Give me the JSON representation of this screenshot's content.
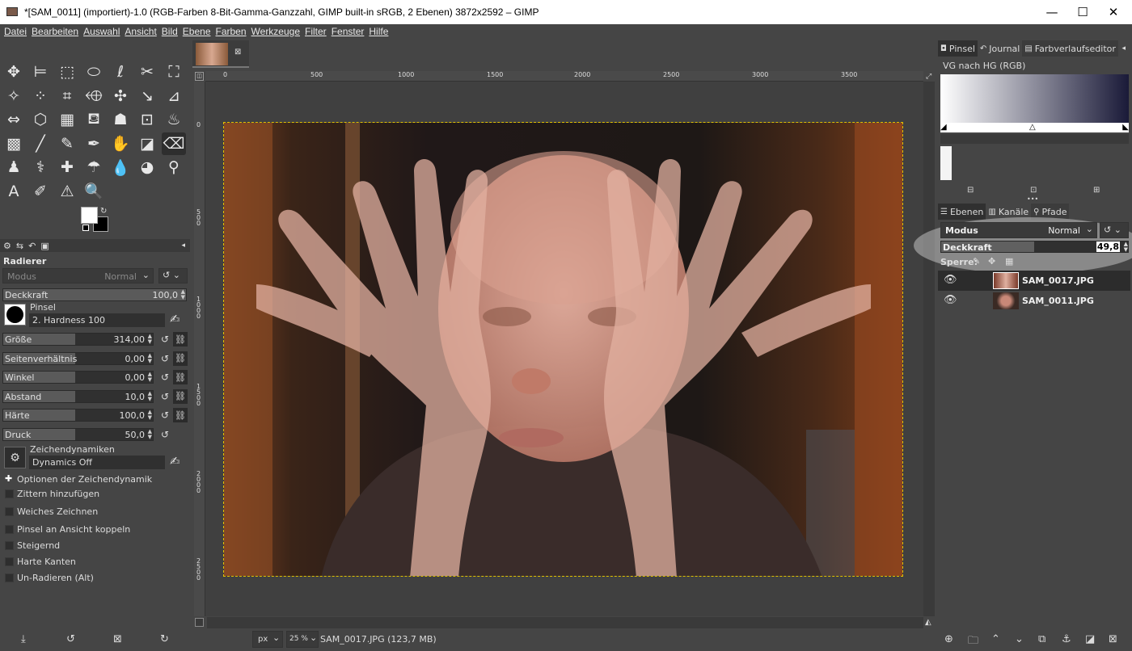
{
  "window": {
    "title": "*[SAM_0011] (importiert)-1.0 (RGB-Farben 8-Bit-Gamma-Ganzzahl, GIMP built-in sRGB, 2 Ebenen) 3872x2592 – GIMP",
    "minimize": "—",
    "maximize": "☐",
    "close": "✕"
  },
  "menu": [
    "Datei",
    "Bearbeiten",
    "Auswahl",
    "Ansicht",
    "Bild",
    "Ebene",
    "Farben",
    "Werkzeuge",
    "Filter",
    "Fenster",
    "Hilfe"
  ],
  "tools": [
    [
      "move-tool-icon",
      "✥"
    ],
    [
      "align-tool-icon",
      "⊨"
    ],
    [
      "rect-select-tool-icon",
      "⬚"
    ],
    [
      "ellipse-select-tool-icon",
      "⬭"
    ],
    [
      "free-select-tool-icon",
      "ℓ"
    ],
    [
      "scissors-tool-icon",
      "✂"
    ],
    [
      "foreground-select-tool-icon",
      "⛶"
    ],
    [
      "fuzzy-select-tool-icon",
      "✧"
    ],
    [
      "color-select-tool-icon",
      "⁘"
    ],
    [
      "crop-tool-icon",
      "⌗"
    ],
    [
      "unified-transform-tool-icon",
      "⬲"
    ],
    [
      "warp-transform-tool-icon",
      "✣"
    ],
    [
      "handle-transform-tool-icon",
      "↘"
    ],
    [
      "shear-tool-icon",
      "⊿"
    ],
    [
      "flip-tool-icon",
      "⇔"
    ],
    [
      "3d-transform-tool-icon",
      "⬡"
    ],
    [
      "cage-transform-tool-icon",
      "▦"
    ],
    [
      "bucket-fill-tool-icon",
      "⛾"
    ],
    [
      "gradient-tool-icon",
      "☗"
    ],
    [
      "perspective-tool-icon",
      "⊡"
    ],
    [
      "fill-tool-icon",
      "♨"
    ],
    [
      "mypaint-brush-tool-icon",
      "▩"
    ],
    [
      "paintbrush-tool-icon",
      "╱"
    ],
    [
      "pencil-tool-icon",
      "✎"
    ],
    [
      "airbrush-tool-icon",
      "✒"
    ],
    [
      "ink-tool-icon",
      "✋"
    ],
    [
      "smudge-tool-icon",
      "◪"
    ],
    [
      "eraser-tool-icon",
      "⌫"
    ],
    [
      "clone-tool-icon",
      "♟"
    ],
    [
      "heal-tool-icon",
      "⚕"
    ],
    [
      "perspective-clone-tool-icon",
      "✚"
    ],
    [
      "blur-tool-icon",
      "☂"
    ],
    [
      "dodge-burn-tool-icon",
      "💧"
    ],
    [
      "sharpen-tool-icon",
      "◕"
    ],
    [
      "paths-tool-icon",
      "⚲"
    ],
    [
      "text-tool-icon",
      "A"
    ],
    [
      "color-picker-tool-icon",
      "✐"
    ],
    [
      "measure-tool-icon",
      "⚠"
    ],
    [
      "zoom-tool-icon",
      "🔍"
    ]
  ],
  "toolOptions": {
    "title": "Radierer",
    "modeLabel": "Modus",
    "modeValue": "Normal",
    "opacityLabel": "Deckkraft",
    "opacityValue": "100,0",
    "brushLabel": "Pinsel",
    "brushValue": "2. Hardness 100",
    "sliders": [
      {
        "label": "Größe",
        "value": "314,00",
        "fill": 0.48
      },
      {
        "label": "Seitenverhältnis",
        "value": "0,00",
        "fill": 0.48
      },
      {
        "label": "Winkel",
        "value": "0,00",
        "fill": 0.48
      },
      {
        "label": "Abstand",
        "value": "10,0",
        "fill": 0.48
      },
      {
        "label": "Härte",
        "value": "100,0",
        "fill": 0.48
      },
      {
        "label": "Druck",
        "value": "50,0",
        "fill": 0.48
      }
    ],
    "dynamicsLabel": "Zeichendynamiken",
    "dynamicsValue": "Dynamics Off",
    "dynamicsOptions": "Optionen der Zeichendynamik",
    "checks": [
      "Zittern hinzufügen",
      "Weiches Zeichnen",
      "Pinsel an Ansicht koppeln",
      "Steigernd",
      "Harte Kanten",
      "Un-Radieren (Alt)"
    ]
  },
  "ruler": {
    "h": [
      "0",
      "500",
      "1000",
      "1500",
      "2000",
      "2500",
      "3000",
      "3500"
    ],
    "v": [
      "0",
      "5 0 0",
      "1 0 0 0",
      "1 5 0 0",
      "2 0 0 0",
      "2 5 0 0"
    ]
  },
  "status": {
    "unit": "px",
    "zoom": "25 %",
    "info": "SAM_0017.JPG (123,7 MB)"
  },
  "gradient": {
    "tabs": [
      "Pinsel",
      "Journal",
      "Farbverlaufseditor"
    ],
    "name": "VG nach HG (RGB)"
  },
  "layers": {
    "tabs": [
      "Ebenen",
      "Kanäle",
      "Pfade"
    ],
    "modeLabel": "Modus",
    "modeValue": "Normal",
    "opacityLabel": "Deckkraft",
    "opacityValue": "49,8",
    "opacity": 0.498,
    "lockLabel": "Sperre:",
    "items": [
      {
        "name": "SAM_0017.JPG"
      },
      {
        "name": "SAM_0011.JPG"
      }
    ]
  },
  "colors": {
    "fg": "#ffffff",
    "bg": "#000000",
    "accent": "#e0c000"
  }
}
